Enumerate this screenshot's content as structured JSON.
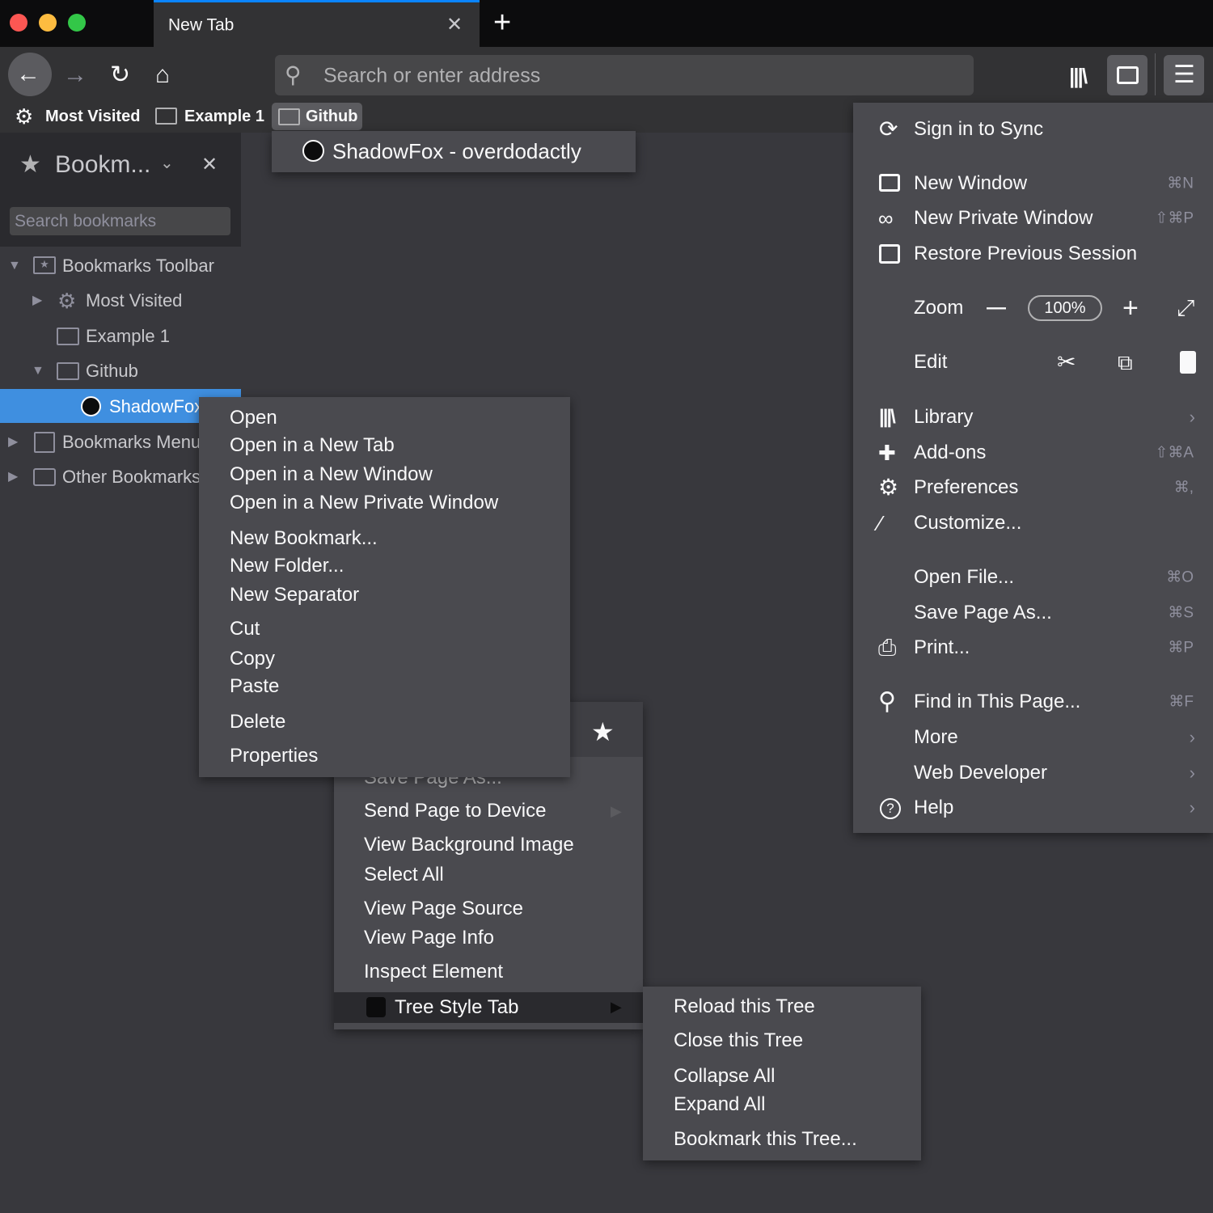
{
  "window": {
    "traffic_lights": {
      "close": "#fc5753",
      "minimize": "#fdbc40",
      "maximize": "#33c748"
    }
  },
  "tab": {
    "title": "New Tab",
    "close": "✕",
    "new_tab": "+"
  },
  "toolbar": {
    "url_placeholder": "Search or enter address"
  },
  "bookmarks_bar": {
    "items": [
      {
        "label": "Most Visited",
        "icon": "gear-icon"
      },
      {
        "label": "Example 1",
        "icon": "folder-icon"
      },
      {
        "label": "Github",
        "icon": "folder-icon"
      }
    ]
  },
  "github_popup": {
    "item": "ShadowFox - overdodactly"
  },
  "sidebar": {
    "title": "Bookm...",
    "search_placeholder": "Search bookmarks",
    "tree": [
      "Bookmarks Toolbar",
      "Most Visited",
      "Example 1",
      "Github",
      "ShadowFox",
      "Bookmarks Menu",
      "Other Bookmarks"
    ]
  },
  "app_menu": {
    "sync": "Sign in to Sync",
    "new_window": {
      "label": "New Window",
      "shortcut": "⌘N"
    },
    "private": {
      "label": "New Private Window",
      "shortcut": "⇧⌘P"
    },
    "restore": "Restore Previous Session",
    "zoom": {
      "label": "Zoom",
      "value": "100%",
      "minus": "—",
      "plus": "+"
    },
    "edit": "Edit",
    "library": "Library",
    "addons": {
      "label": "Add-ons",
      "shortcut": "⇧⌘A"
    },
    "preferences": {
      "label": "Preferences",
      "shortcut": "⌘,"
    },
    "customize": "Customize...",
    "open_file": {
      "label": "Open File...",
      "shortcut": "⌘O"
    },
    "save_page": {
      "label": "Save Page As...",
      "shortcut": "⌘S"
    },
    "print": {
      "label": "Print...",
      "shortcut": "⌘P"
    },
    "find": {
      "label": "Find in This Page...",
      "shortcut": "⌘F"
    },
    "more": "More",
    "web_developer": "Web Developer",
    "help": "Help"
  },
  "bookmark_context": [
    "Open",
    "Open in a New Tab",
    "Open in a New Window",
    "Open in a New Private Window",
    "New Bookmark...",
    "New Folder...",
    "New Separator",
    "Cut",
    "Copy",
    "Paste",
    "Delete",
    "Properties"
  ],
  "page_context": [
    "Save Page As...",
    "Send Page to Device",
    "View Background Image",
    "Select All",
    "View Page Source",
    "View Page Info",
    "Inspect Element",
    "Tree Style Tab"
  ],
  "tst_submenu": [
    "Reload this Tree",
    "Close this Tree",
    "Collapse All",
    "Expand All",
    "Bookmark this Tree..."
  ]
}
